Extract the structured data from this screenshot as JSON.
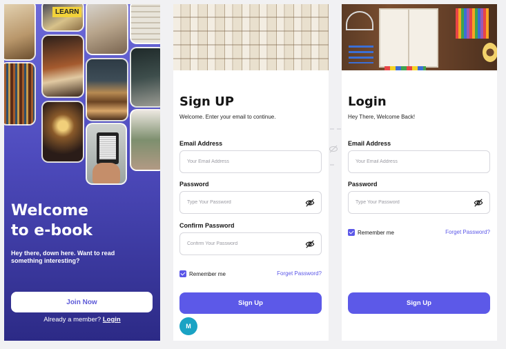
{
  "welcome": {
    "collage_badge": "LEARN",
    "title_line1": "Welcome",
    "title_line2": "to e-book",
    "subtitle": "Hey there, down here. Want to read something interesting?",
    "join_label": "Join Now",
    "member_text": "Already a member?",
    "member_link": "Login"
  },
  "signup": {
    "title": "Sign UP",
    "subtitle": "Welcome. Enter your email to continue.",
    "email_label": "Email Address",
    "email_placeholder": "Your Email Address",
    "password_label": "Password",
    "password_placeholder": "Type Your Password",
    "confirm_label": "Confirm Password",
    "confirm_placeholder": "Confirm Your Password",
    "remember_label": "Remember me",
    "forgot_label": "Forget Password?",
    "submit_label": "Sign Up",
    "avatar_initial": "M"
  },
  "login": {
    "title": "Login",
    "subtitle": "Hey There, Welcome Back!",
    "email_label": "Email Address",
    "email_placeholder": "Your Email Address",
    "password_label": "Password",
    "password_placeholder": "Type Your Password",
    "remember_label": "Remember me",
    "forgot_label": "Forget Password?",
    "submit_label": "Sign Up"
  },
  "colors": {
    "accent": "#5c59e8",
    "welcome_gradient_top": "#6d6ad9",
    "welcome_gradient_bottom": "#2c2a86"
  },
  "icons": [
    "eye-off-icon",
    "checkbox-checked-icon",
    "avatar-icon"
  ]
}
